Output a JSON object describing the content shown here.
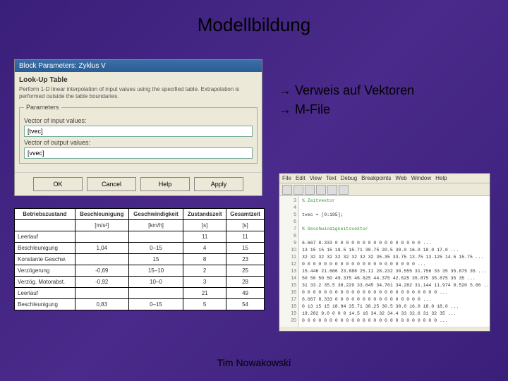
{
  "title": "Modellbildung",
  "bullets": {
    "arrow": "→",
    "item1": "Verweis auf Vektoren",
    "item2": "M-File"
  },
  "dialog": {
    "title": "Block Parameters: Zyklus V",
    "section": "Look-Up Table",
    "desc": "Perform 1-D linear interpolation of input values using the specified table. Extrapolation is performed outside the table boundaries.",
    "params_legend": "Parameters",
    "label1": "Vector of input values:",
    "value1": "[tvec]",
    "label2": "Vector of output values:",
    "value2": "[vvec]",
    "btn_ok": "OK",
    "btn_cancel": "Cancel",
    "btn_help": "Help",
    "btn_apply": "Apply"
  },
  "table": {
    "headers": [
      "Betriebszustand",
      "Beschleunigung",
      "Geschwindigkeit",
      "Zustandszeit",
      "Gesamtzeit"
    ],
    "units": [
      "",
      "[m/s²]",
      "[km/h]",
      "[s]",
      "[s]"
    ],
    "rows": [
      [
        "Leerlauf",
        "",
        "",
        "11",
        "11"
      ],
      [
        "Beschleunigung",
        "1,04",
        "0–15",
        "4",
        "15"
      ],
      [
        "Konstante Geschw.",
        "",
        "15",
        "8",
        "23"
      ],
      [
        "Verzögerung",
        "-0,69",
        "15–10",
        "2",
        "25"
      ],
      [
        "Verzög. Motorabst.",
        "-0,92",
        "10–0",
        "3",
        "28"
      ],
      [
        "Leerlauf",
        "",
        "",
        "21",
        "49"
      ],
      [
        "Beschleunigung",
        "0,83",
        "0–15",
        "5",
        "54"
      ]
    ]
  },
  "editor": {
    "menu": [
      "File",
      "Edit",
      "View",
      "Text",
      "Debug",
      "Breakpoints",
      "Web",
      "Window",
      "Help"
    ],
    "gutter": [
      "3",
      "4",
      "5",
      "6",
      "7",
      "8",
      "9",
      "10",
      "11",
      "12",
      "13",
      "14",
      "15",
      "16",
      "17",
      "18",
      "19",
      "20"
    ],
    "code_lines": [
      {
        "t": "% Zeitvektor",
        "c": "cm"
      },
      {
        "t": "",
        "c": ""
      },
      {
        "t": "tvec = [0:195];",
        "c": ""
      },
      {
        "t": "",
        "c": ""
      },
      {
        "t": "% Geschwindigkeitsvektor",
        "c": "cm"
      },
      {
        "t": "",
        "c": ""
      },
      {
        "t": "6.667 8.333 0 0 0 0 0 0 0 0 0 0 0 0 0 0 0 0 ...",
        "c": ""
      },
      {
        "t": "13 15 15 15 18.5 15.71 38.75 20.5 30.0 16.0 18.0 17.0 ...",
        "c": ""
      },
      {
        "t": "32 32 32 32 32 32 32 32 32 35.35 33.75 13.75 13.125 14.5 15.75 ...",
        "c": ""
      },
      {
        "t": "0 0 0 0 0 0 0 0 0 0 0 0 0 0 0 0 0 0 0 0 0 ...",
        "c": ""
      },
      {
        "t": "15.446 21.666 23.888 25.11 28.232 30.555 31.756 33 35 35.875 35 ...",
        "c": ""
      },
      {
        "t": "50 50 50 50 49.375 46.625 44.375 42.625 35.875 35.875 35 35 ...",
        "c": ""
      },
      {
        "t": "31 33.2 35.5 38.229 33.645 34.761 34.282 31.144 11.974 8.520 5.06 ...",
        "c": ""
      },
      {
        "t": "0 0 0 0 0 0 0 0 0 0 0 0 0 0 0 0 0 0 0 0 0 0 0 0 0 ...",
        "c": ""
      },
      {
        "t": "6.667 8.333 0 0 0 0 0 0 0 0 0 0 0 0 0 0 0 0 ...",
        "c": ""
      },
      {
        "t": "0 13 15 15 18.94 35.71 38.25 30.5 30.0 16.0 18.0 18.0 ...",
        "c": ""
      },
      {
        "t": "19.282 9.0 0 0 0 14.5 16 34.32 34.4 33 32.6 31 32 35 ...",
        "c": ""
      },
      {
        "t": "0 0 0 0 0 0 0 0 0 0 0 0 0 0 0 0 0 0 0 0 0 0 0 0 0 ...",
        "c": ""
      }
    ]
  },
  "footer": "Tim Nowakowski"
}
